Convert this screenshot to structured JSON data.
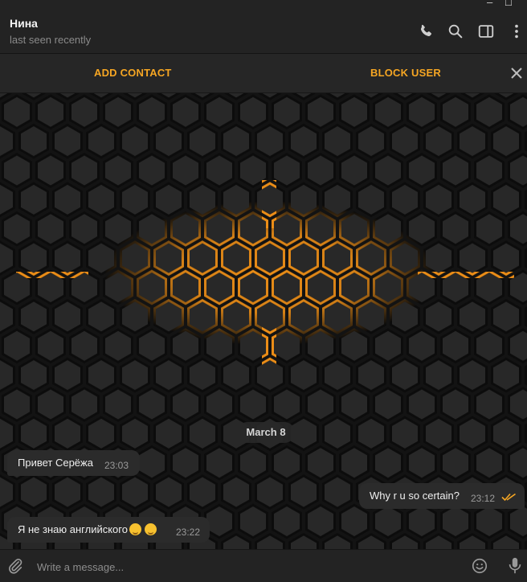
{
  "header": {
    "name": "Нина",
    "status": "last seen recently",
    "icons": [
      "phone-icon",
      "search-icon",
      "sidebar-toggle-icon",
      "more-vertical-icon"
    ]
  },
  "window": {
    "minimize_glyph": "–",
    "maximize_glyph": "☐"
  },
  "action_bar": {
    "add_contact": "ADD CONTACT",
    "block_user": "BLOCK USER",
    "close_icon": "close-icon"
  },
  "chat": {
    "date": "March 8",
    "messages": [
      {
        "direction": "in",
        "text": "Привет Серёжа",
        "time": "23:03"
      },
      {
        "direction": "out",
        "text": "Why r u so certain?",
        "time": "23:12",
        "status": "read-double-check"
      },
      {
        "direction": "in",
        "text": "Я не знаю английского",
        "time": "23:22",
        "emojis": [
          "relieved-face",
          "shushing-face"
        ]
      }
    ]
  },
  "composer": {
    "placeholder": "Write a message...",
    "icons": [
      "attach-icon",
      "emoji-icon",
      "mic-icon"
    ]
  },
  "colors": {
    "accent": "#f6a623",
    "background": "#1e1e1e",
    "bubble": "#2b2b2b",
    "glow": "#ff9a1a"
  }
}
